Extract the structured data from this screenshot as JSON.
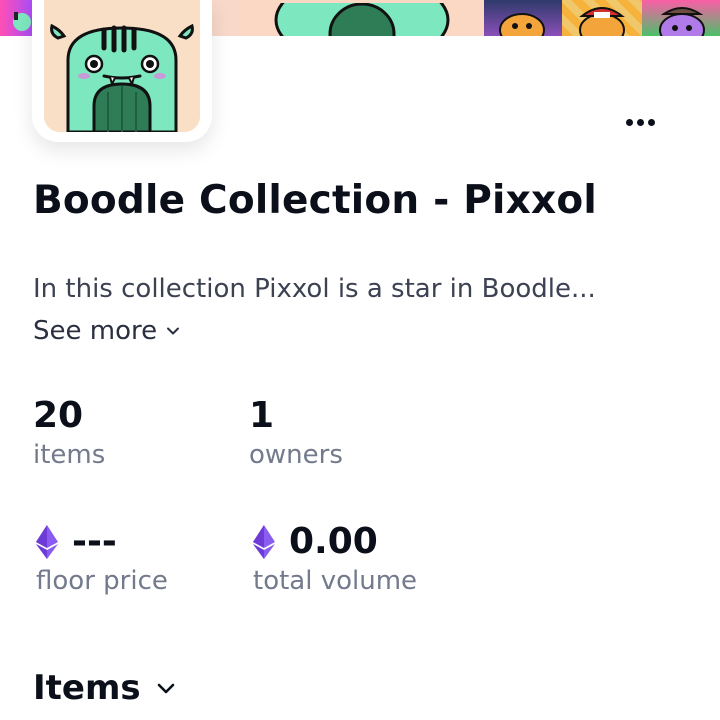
{
  "collection": {
    "title": "Boodle Collection - Pixxol",
    "description": "In this collection Pixxol is a star in Boodle...",
    "see_more_label": "See more",
    "more_menu_icon": "more-horizontal-icon"
  },
  "stats": {
    "items": {
      "value": "20",
      "label": "items"
    },
    "owners": {
      "value": "1",
      "label": "owners"
    },
    "floor_price": {
      "value": "---",
      "label": "floor price",
      "icon": "ethereum-icon"
    },
    "total_volume": {
      "value": "0.00",
      "label": "total volume",
      "icon": "ethereum-icon"
    }
  },
  "items_section": {
    "heading": "Items",
    "icon": "chevron-down-icon"
  },
  "colors": {
    "text_primary": "#0b0f1a",
    "text_secondary": "#737a8c",
    "character_green": "#7de8c0",
    "eth_purple": "#6f3bd6"
  }
}
